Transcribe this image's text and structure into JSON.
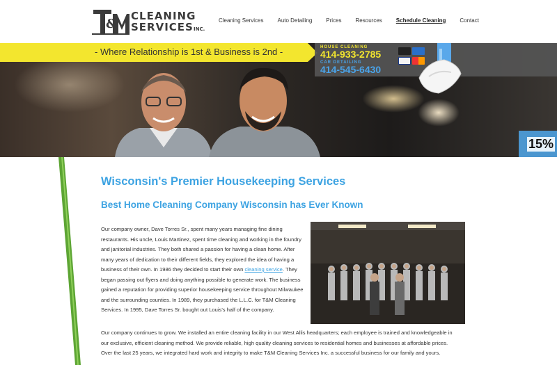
{
  "logo": {
    "word1": "CLEANING",
    "word2": "SERVICES",
    "inc": "INC."
  },
  "nav": {
    "items": [
      "Cleaning Services",
      "Auto Detailing",
      "Prices",
      "Resources",
      "Schedule Cleaning",
      "Contact"
    ],
    "active": "Schedule Cleaning"
  },
  "hero": {
    "tagline": "- Where Relationship is 1st & Business is 2nd -",
    "house_label": "HOUSE CLEANING",
    "house_phone": "414-933-2785",
    "car_label": "CAR DETAILING",
    "car_phone": "414-545-6430",
    "promo": "15%"
  },
  "content": {
    "title": "Wisconsin's Premier Housekeeping Services",
    "subtitle": "Best Home Cleaning Company Wisconsin has Ever Known",
    "para1_before": "Our company owner, Dave Torres Sr., spent many years managing fine dining restaurants. His uncle, Louis Martinez, spent time cleaning and working in the foundry and janitorial industries. They both shared a passion for having a clean home. After many years of dedication to their different fields, they explored the idea of having a business of their own. In 1986 they decided to start their own",
    "para1_link": "cleaning service",
    "para1_after": ". They began passing out flyers and doing anything possible to generate work. The business gained a reputation for providing superior housekeeping service throughout Milwaukee and the surrounding counties. In 1989, they purchased the L.L.C. for T&M Cleaning Services. In 1995, Dave Torres Sr. bought out Louis's half of the company.",
    "para2": "Our company continues to grow. We installed an entire cleaning facility in our West Allis headquarters; each employee is trained and knowledgeable in our exclusive, efficient cleaning method. We provide reliable, high quality cleaning services to residential homes and businesses at affordable prices. Over the last 25 years, we integrated hard work and integrity to make T&M Cleaning Services Inc. a successful business for our family and yours."
  },
  "colors": {
    "accent_blue": "#3da3e2",
    "yellow": "#f3e62e",
    "promo_blue": "#4b96cf"
  }
}
